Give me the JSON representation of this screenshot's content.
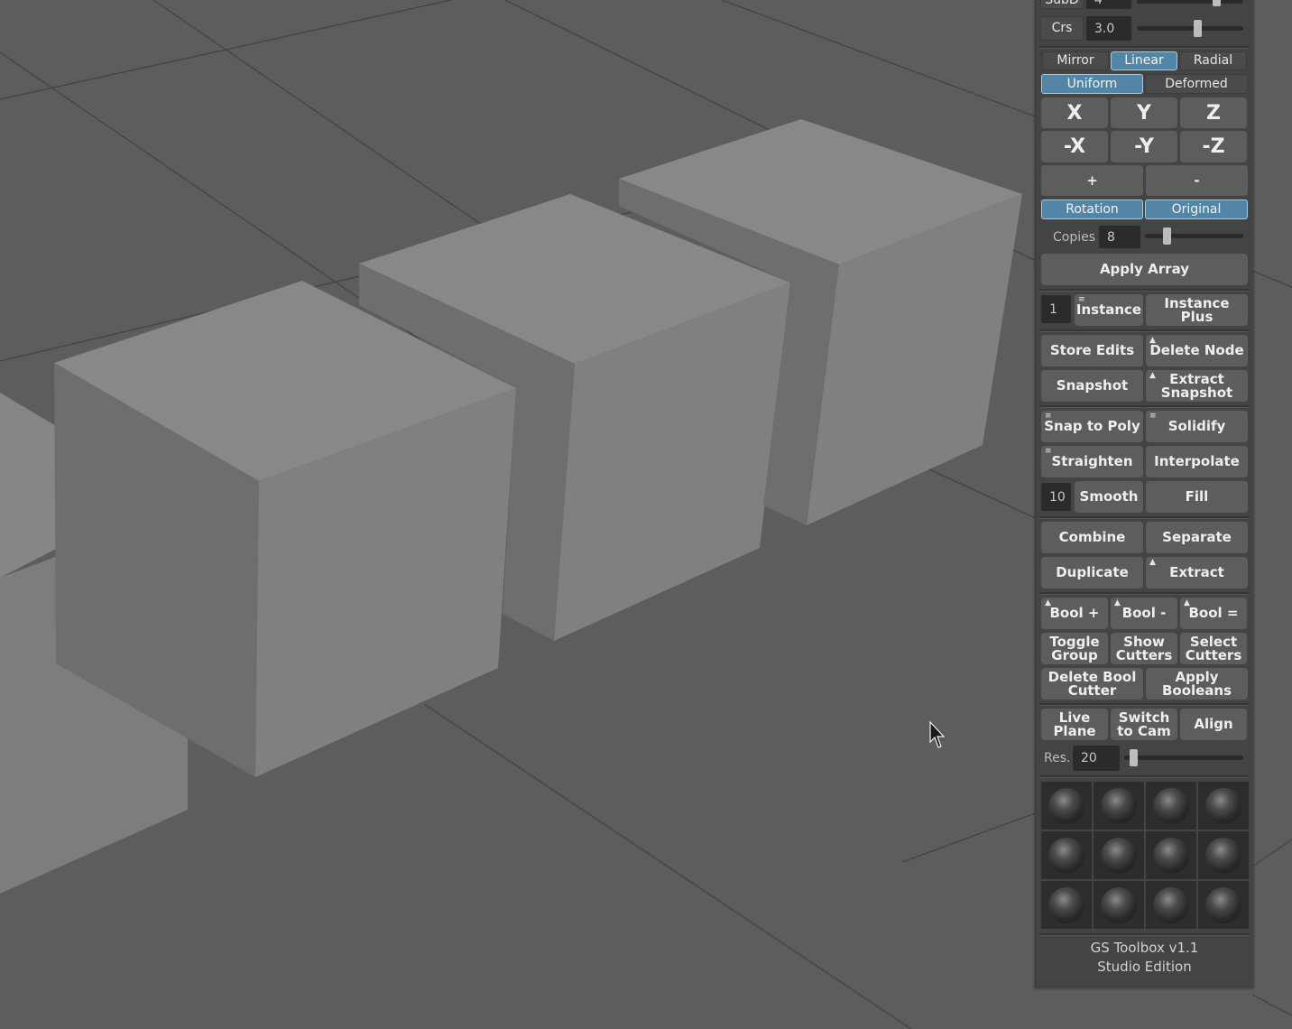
{
  "panel": {
    "top_row": {
      "label": "SubD",
      "value": "4"
    },
    "crease": {
      "label": "Crs",
      "value": "3.0"
    },
    "array_mode": {
      "mirror": "Mirror",
      "linear": "Linear",
      "radial": "Radial"
    },
    "spacing_mode": {
      "uniform": "Uniform",
      "deformed": "Deformed"
    },
    "axes_pos": [
      "X",
      "Y",
      "Z"
    ],
    "axes_neg": [
      "-X",
      "-Y",
      "-Z"
    ],
    "add_label": "+",
    "remove_label": "-",
    "rotation_label": "Rotation",
    "original_label": "Original",
    "copies": {
      "label": "Copies",
      "value": "8"
    },
    "apply_array": "Apply Array",
    "instance_count": "1",
    "instance": "Instance",
    "instance_plus": "Instance Plus",
    "store_edits": "Store Edits",
    "delete_node": "Delete Node",
    "snapshot": "Snapshot",
    "extract_snapshot": "Extract Snapshot",
    "snap_to_poly": "Snap to Poly",
    "solidify": "Solidify",
    "straighten": "Straighten",
    "interpolate": "Interpolate",
    "smooth_count": "10",
    "smooth": "Smooth",
    "fill": "Fill",
    "combine": "Combine",
    "separate": "Separate",
    "duplicate": "Duplicate",
    "extract": "Extract",
    "bool_plus": "Bool +",
    "bool_minus": "Bool -",
    "bool_equal": "Bool =",
    "toggle_group": "Toggle Group",
    "show_cutters": "Show Cutters",
    "select_cutters": "Select Cutters",
    "delete_bool_cutter": "Delete Bool Cutter",
    "apply_booleans": "Apply Booleans",
    "live_plane": "Live Plane",
    "switch_to_cam": "Switch to Cam",
    "align": "Align",
    "resolution": {
      "label": "Res.",
      "value": "20"
    },
    "footer_line1": "GS Toolbox v1.1",
    "footer_line2": "Studio Edition"
  },
  "colors": {
    "active_toggle": "#5285a6",
    "panel_bg": "#444444",
    "viewport_bg": "#5d5d5d"
  }
}
